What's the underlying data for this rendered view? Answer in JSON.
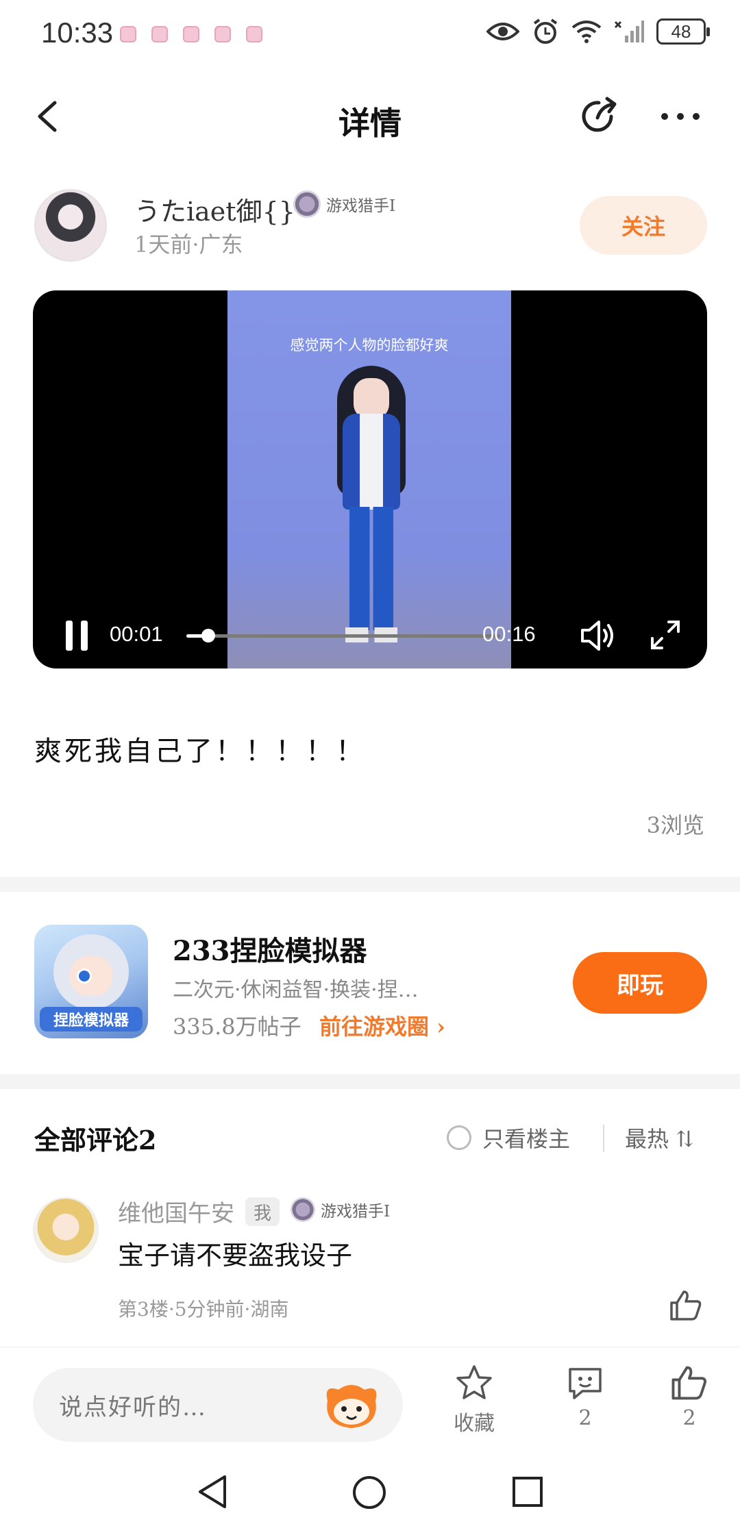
{
  "status_bar": {
    "time": "10:33",
    "battery": "48"
  },
  "header": {
    "title": "详情"
  },
  "author": {
    "name": "うたiaet御{}",
    "badge": "游戏猎手Ⅰ",
    "meta": "1天前·广东",
    "follow_label": "关注"
  },
  "video": {
    "caption": "感觉两个人物的脸都好爽",
    "current_time": "00:01",
    "total_time": "00:16",
    "progress_fraction": 0.07
  },
  "post": {
    "text": "爽死我自己了！！！！！",
    "views": "3浏览"
  },
  "game": {
    "name": "233捏脸模拟器",
    "tags": "二次元·休闲益智·换装·捏…",
    "posts": "335.8万帖子",
    "link": "前往游戏圈 ›",
    "play_label": "即玩",
    "icon_text": "捏脸模拟器"
  },
  "comments": {
    "title": "全部评论2",
    "only_op": "只看楼主",
    "sort": "最热 ⇅",
    "items": [
      {
        "name": "维他国午安",
        "me_tag": "我",
        "badge": "游戏猎手Ⅰ",
        "text": "宝子请不要盗我设子",
        "meta": "第3楼·5分钟前·湖南"
      }
    ]
  },
  "bottom_bar": {
    "placeholder": "说点好听的…",
    "favorite_label": "收藏",
    "comment_count": "2",
    "like_count": "2"
  },
  "colors": {
    "accent": "#fa6d14",
    "accent_text": "#f27a2c",
    "follow_bg": "#fdeee4"
  },
  "icons": [
    "back-icon",
    "share-icon",
    "more-icon",
    "pause-icon",
    "volume-icon",
    "fullscreen-icon",
    "star-icon",
    "comment-icon",
    "thumb-up-icon"
  ]
}
